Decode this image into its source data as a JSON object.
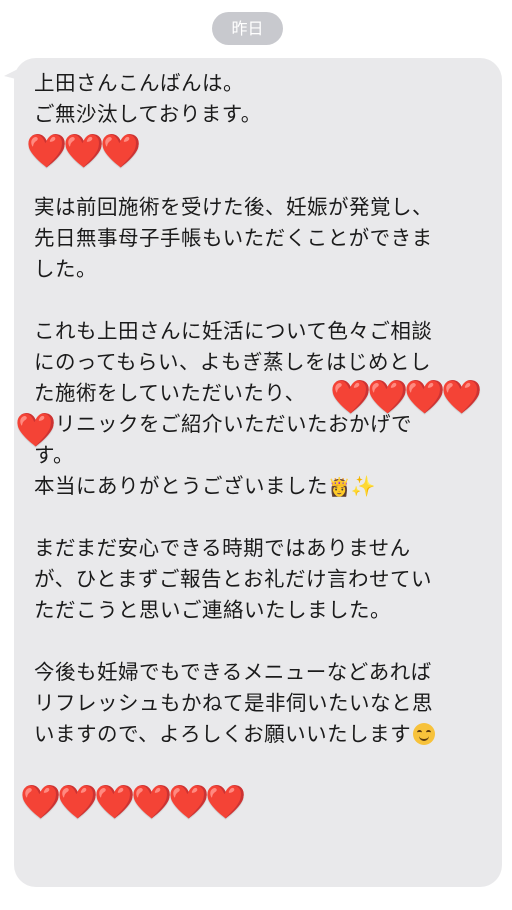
{
  "date_label": "昨日",
  "message": {
    "lines": [
      "上田さんこんばんは。",
      "ご無沙汰しております。",
      "",
      "",
      "実は前回施術を受けた後、妊娠が発覚し、",
      "先日無事母子手帳もいただくことができま",
      "した。",
      "",
      "これも上田さんに妊活について色々ご相談",
      "にのってもらい、よもぎ蒸しをはじめとし",
      "た施術をしていただいたり、",
      "クリニックをご紹介いただいたおかげで",
      "す。",
      "本当にありがとうございました",
      "",
      "まだまだ安心できる時期ではありません",
      "が、ひとまずご報告とお礼だけ言わせてい",
      "ただこうと思いご連絡いたしました。",
      "",
      "今後も妊婦でもできるメニューなどあれば",
      "リフレッシュもかねて是非伺いたいなと思",
      "いますので、よろしくお願いいたします"
    ]
  },
  "emoji": {
    "heart": "❤️",
    "princess": "👸",
    "sparkles": "✨",
    "smile": "smiling-face-icon"
  },
  "colors": {
    "bubble": "#e9e9eb",
    "date_pill": "#c8c9ce",
    "text": "#1b1b1b",
    "heart": "#e8141b"
  }
}
